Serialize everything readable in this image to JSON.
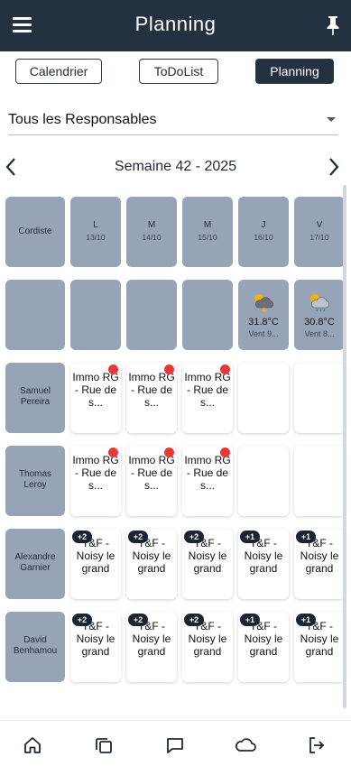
{
  "app": {
    "title": "Planning"
  },
  "tabs": [
    {
      "label": "Calendrier",
      "active": false
    },
    {
      "label": "ToDoList",
      "active": false
    },
    {
      "label": "Planning",
      "active": true
    }
  ],
  "responsable_select": {
    "value": "Tous les Responsables"
  },
  "week": {
    "label": "Semaine 42 - 2025"
  },
  "grid": {
    "corner_label": "Cordiste",
    "days": [
      {
        "letter": "L",
        "date": "13/10"
      },
      {
        "letter": "M",
        "date": "14/10"
      },
      {
        "letter": "M",
        "date": "15/10"
      },
      {
        "letter": "J",
        "date": "16/10"
      },
      {
        "letter": "V",
        "date": "17/10"
      }
    ],
    "weather": [
      null,
      null,
      null,
      {
        "icon": "storm-cloud-sun-icon",
        "temp": "31.8°C",
        "wind": "Vent 9..."
      },
      {
        "icon": "rain-cloud-sun-icon",
        "temp": "30.8°C",
        "wind": "Vent 8..."
      }
    ],
    "rows": [
      {
        "name": "Samuel Pereira",
        "cells": [
          {
            "text": "Immo RG - Rue de s...",
            "dot": true
          },
          {
            "text": "Immo RG - Rue de s...",
            "dot": true
          },
          {
            "text": "Immo RG - Rue de s...",
            "dot": true
          },
          null,
          null
        ]
      },
      {
        "name": "Thomas Leroy",
        "cells": [
          {
            "text": "Immo RG - Rue de s...",
            "dot": true
          },
          {
            "text": "Immo RG - Rue de s...",
            "dot": true
          },
          {
            "text": "Immo RG - Rue de s...",
            "dot": true
          },
          null,
          null
        ]
      },
      {
        "name": "Alexandre Garnier",
        "cells": [
          {
            "text": "T&F -Noisy le grand",
            "badge": "+2"
          },
          {
            "text": "T&F -Noisy le grand",
            "badge": "+2"
          },
          {
            "text": "T&F -Noisy le grand",
            "badge": "+2"
          },
          {
            "text": "T&F -Noisy le grand",
            "badge": "+1"
          },
          {
            "text": "T&F -Noisy le grand",
            "badge": "+1"
          }
        ]
      },
      {
        "name": "David Benhamou",
        "cells": [
          {
            "text": "T&F -Noisy le grand",
            "badge": "+2"
          },
          {
            "text": "T&F -Noisy le grand",
            "badge": "+2"
          },
          {
            "text": "T&F -Noisy le grand",
            "badge": "+2"
          },
          {
            "text": "T&F -Noisy le grand",
            "badge": "+1"
          },
          {
            "text": "T&F -Noisy le grand",
            "badge": "+1"
          }
        ]
      }
    ]
  },
  "bottom_nav": [
    {
      "icon": "home-icon"
    },
    {
      "icon": "copy-icon"
    },
    {
      "icon": "chat-icon"
    },
    {
      "icon": "cloud-icon"
    },
    {
      "icon": "logout-icon"
    }
  ],
  "colors": {
    "header_bg": "#243140",
    "cell_gray": "#97a3b7",
    "alert_red": "#e53935",
    "badge_bg": "#1b2430"
  }
}
